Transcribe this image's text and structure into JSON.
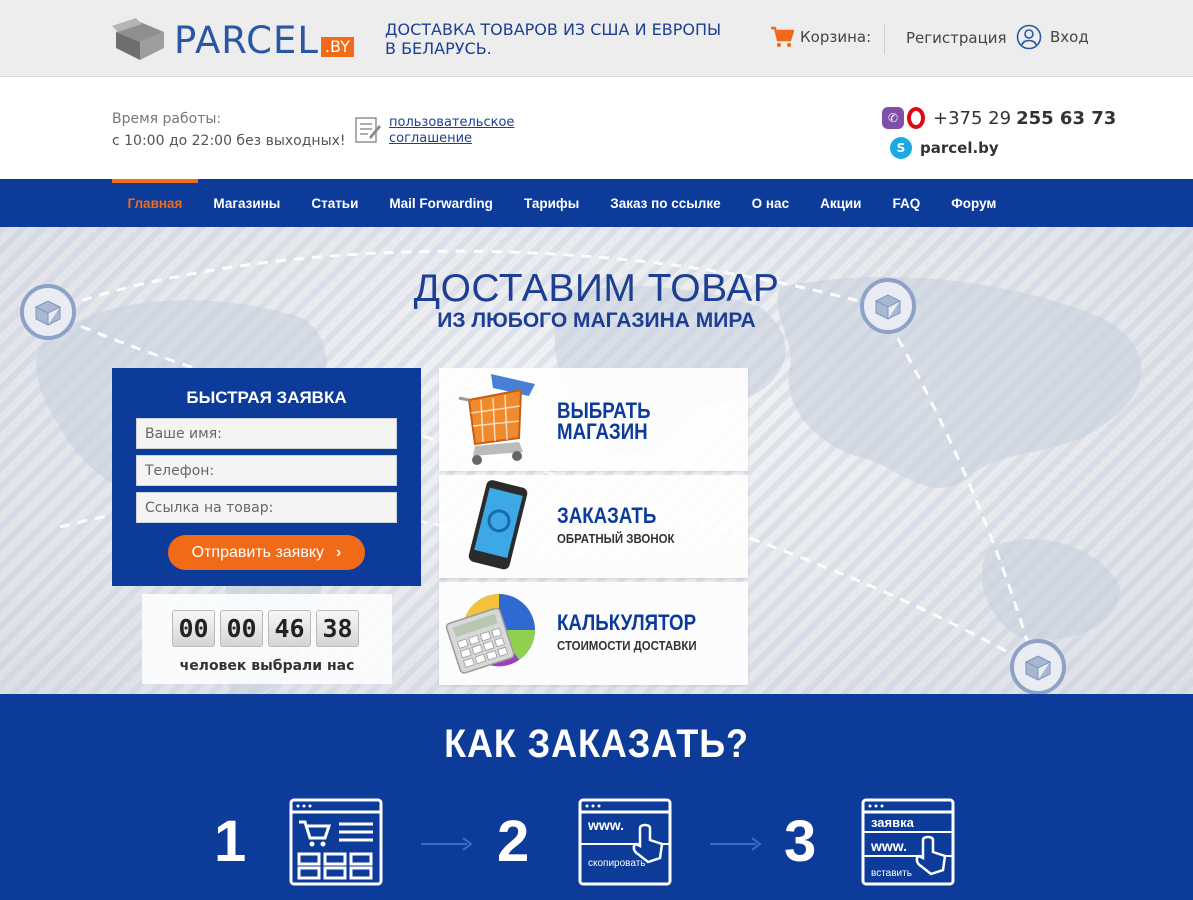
{
  "header": {
    "logo_text": "PARCEL",
    "logo_badge": ".BY",
    "tagline": "ДОСТАВКА ТОВАРОВ ИЗ США И ЕВРОПЫ В БЕЛАРУСЬ.",
    "cart_label": "Корзина:",
    "register_label": "Регистрация",
    "login_label": "Вход"
  },
  "info": {
    "hours_label": "Время работы:",
    "hours_value": "с 10:00 до 22:00 без выходных!",
    "agreement_link": "пользовательское соглашение",
    "phone_prefix": "+375 29",
    "phone_number": "255 63 73",
    "skype": "parcel.by"
  },
  "nav": {
    "items": [
      {
        "label": "Главная",
        "active": true
      },
      {
        "label": "Магазины"
      },
      {
        "label": "Статьи"
      },
      {
        "label": "Mail Forwarding"
      },
      {
        "label": "Тарифы"
      },
      {
        "label": "Заказ по ссылке"
      },
      {
        "label": "О нас"
      },
      {
        "label": "Акции"
      },
      {
        "label": "FAQ"
      },
      {
        "label": "Форум"
      }
    ]
  },
  "hero": {
    "title": "ДОСТАВИМ ТОВАР",
    "subtitle": "ИЗ ЛЮБОГО МАГАЗИНА МИРА"
  },
  "form": {
    "title": "БЫСТРАЯ ЗАЯВКА",
    "name_placeholder": "Ваше имя:",
    "phone_placeholder": "Телефон:",
    "link_placeholder": "Ссылка на товар:",
    "submit_label": "Отправить заявку",
    "submit_chevron": "›"
  },
  "counter": {
    "digits": [
      "00",
      "00",
      "46",
      "38"
    ],
    "label": "человек выбрали нас"
  },
  "cards": [
    {
      "title_line1": "ВЫБРАТЬ",
      "title_line2": "МАГАЗИН",
      "sub": ""
    },
    {
      "title_line1": "ЗАКАЗАТЬ",
      "title_line2": "",
      "sub": "ОБРАТНЫЙ ЗВОНОК"
    },
    {
      "title_line1": "КАЛЬКУЛЯТОР",
      "title_line2": "",
      "sub": "СТОИМОСТИ ДОСТАВКИ"
    }
  ],
  "how": {
    "title": "КАК ЗАКАЗАТЬ?",
    "steps": [
      {
        "num": "1"
      },
      {
        "num": "2",
        "url_text": "www.",
        "caption": "скопировать"
      },
      {
        "num": "3",
        "form_text": "заявка",
        "url_text": "www.",
        "caption": "вставить"
      }
    ]
  },
  "colors": {
    "brand_blue": "#0c3b9a",
    "accent_orange": "#f06a17"
  }
}
